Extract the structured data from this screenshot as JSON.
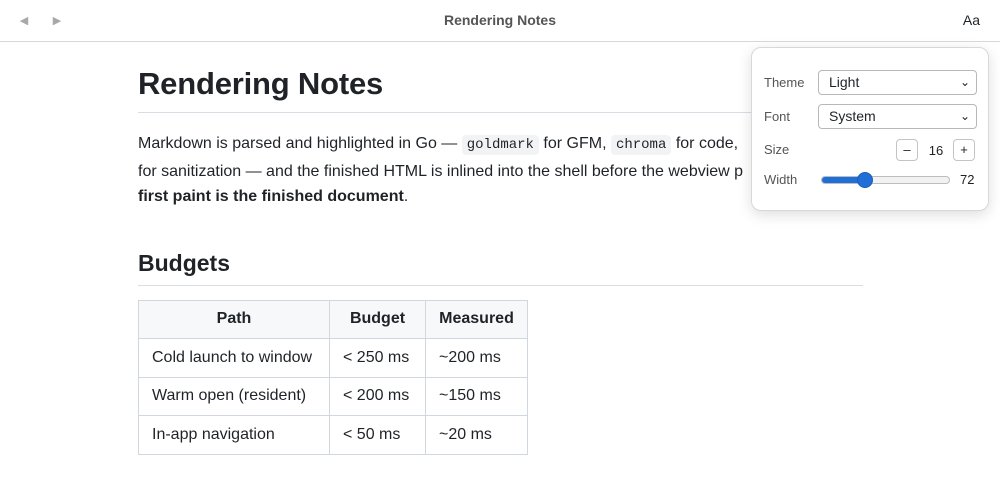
{
  "toolbar": {
    "back_icon": "triangle-left-icon",
    "forward_icon": "triangle-right-icon",
    "title": "Rendering Notes",
    "aa_label": "Aa"
  },
  "document": {
    "heading": "Rendering Notes",
    "intro": {
      "t1": "Markdown is parsed and highlighted in Go — ",
      "code1": "goldmark",
      "t2": " for GFM, ",
      "code2": "chroma",
      "t3": " for code, ",
      "t4": "for sanitization — and the finished HTML is inlined into the shell before the webview p",
      "bold": "first paint is the finished document",
      "t5": "."
    },
    "section_heading": "Budgets",
    "table": {
      "headers": [
        "Path",
        "Budget",
        "Measured"
      ],
      "rows": [
        [
          "Cold launch to window",
          "< 250 ms",
          "~200 ms"
        ],
        [
          "Warm open (resident)",
          "< 200 ms",
          "~150 ms"
        ],
        [
          "In-app navigation",
          "< 50 ms",
          "~20 ms"
        ]
      ]
    }
  },
  "settings": {
    "theme_label": "Theme",
    "theme_value": "Light",
    "font_label": "Font",
    "font_value": "System",
    "size_label": "Size",
    "size_value": "16",
    "size_decrement": "–",
    "size_increment": "+",
    "width_label": "Width",
    "width_value": "72",
    "width_fraction": 0.34
  },
  "colors": {
    "accent": "#1f6fd6",
    "border": "#d0d7de",
    "table_header_bg": "#f6f8fa",
    "code_bg": "#f2f3f5"
  }
}
